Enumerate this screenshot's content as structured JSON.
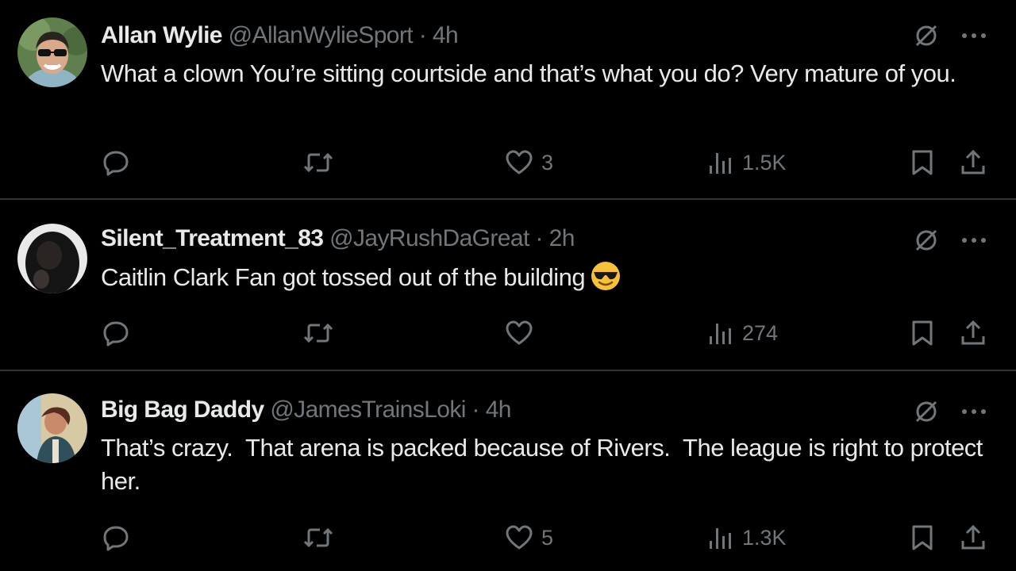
{
  "tweets": [
    {
      "name": "Allan Wylie",
      "handle": "@AllanWylieSport",
      "sep": "·",
      "time": "4h",
      "text": "What a clown You’re sitting courtside and that’s what you do? Very mature of you.",
      "replies": "",
      "retweets": "",
      "likes": "3",
      "views": "1.5K",
      "avatar_color": "#6d8a5a"
    },
    {
      "name": "Silent_Treatment_83",
      "handle": "@JayRushDaGreat",
      "sep": "·",
      "time": "2h",
      "text": "Caitlin Clark Fan got tossed out of the building",
      "emoji": "smiling-face-with-sunglasses",
      "replies": "",
      "retweets": "",
      "likes": "",
      "views": "274",
      "avatar_color": "#1a1a1a"
    },
    {
      "name": "Big Bag Daddy",
      "handle": "@JamesTrainsLoki",
      "sep": "·",
      "time": "4h",
      "text": "That’s crazy.  That arena is packed because of Rivers.  The league is right to protect her.",
      "replies": "",
      "retweets": "",
      "likes": "5",
      "views": "1.3K",
      "avatar_color": "#c9a96e"
    }
  ],
  "icons": {
    "reply": "reply-icon",
    "retweet": "retweet-icon",
    "like": "heart-icon",
    "views": "views-icon",
    "bookmark": "bookmark-icon",
    "share": "share-icon",
    "grok": "grok-icon",
    "more": "more-icon"
  },
  "colors": {
    "background": "#000000",
    "text": "#e7e9ea",
    "muted": "#71767b",
    "divider": "#2f3336"
  }
}
